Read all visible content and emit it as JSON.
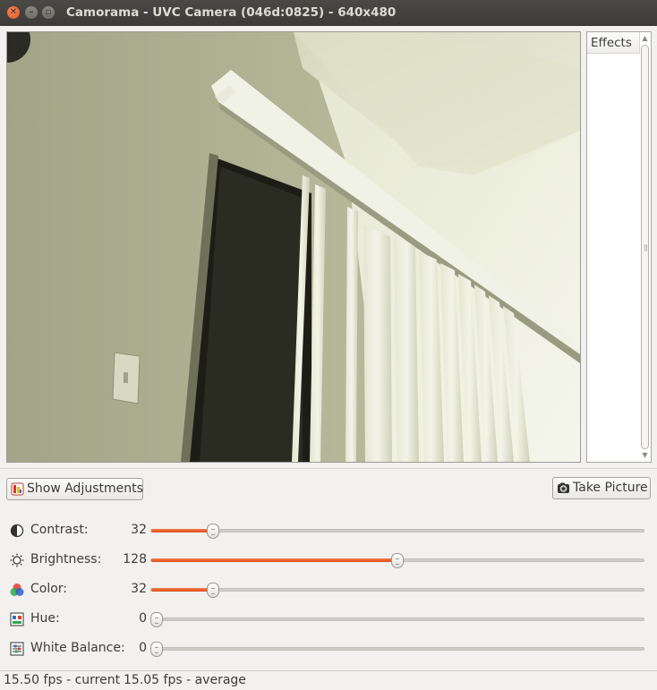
{
  "window": {
    "title": "Camorama - UVC Camera (046d:0825) - 640x480",
    "controls": [
      "close-icon",
      "minimize-icon",
      "maximize-icon"
    ]
  },
  "effects": {
    "header": "Effects"
  },
  "toolbar": {
    "show_adjustments_label": "Show Adjustments",
    "take_picture_label": "Take Picture"
  },
  "adjustments": [
    {
      "label": "Contrast:",
      "value": "32",
      "level": 0.125,
      "icon": "contrast-icon"
    },
    {
      "label": "Brightness:",
      "value": "128",
      "level": 0.5,
      "icon": "brightness-icon"
    },
    {
      "label": "Color:",
      "value": "32",
      "level": 0.125,
      "icon": "color-wheel-icon"
    },
    {
      "label": "Hue:",
      "value": "0",
      "level": 0.0,
      "icon": "hue-icon"
    },
    {
      "label": "White Balance:",
      "value": "0",
      "level": 0.0,
      "icon": "white-balance-icon"
    }
  ],
  "status": {
    "current": "15.50 fps - current",
    "average": "15.05 fps - average"
  },
  "colors": {
    "accent": "#e0531f",
    "titlebar": "#3c3b37",
    "window_bg": "#f2f1f0"
  }
}
